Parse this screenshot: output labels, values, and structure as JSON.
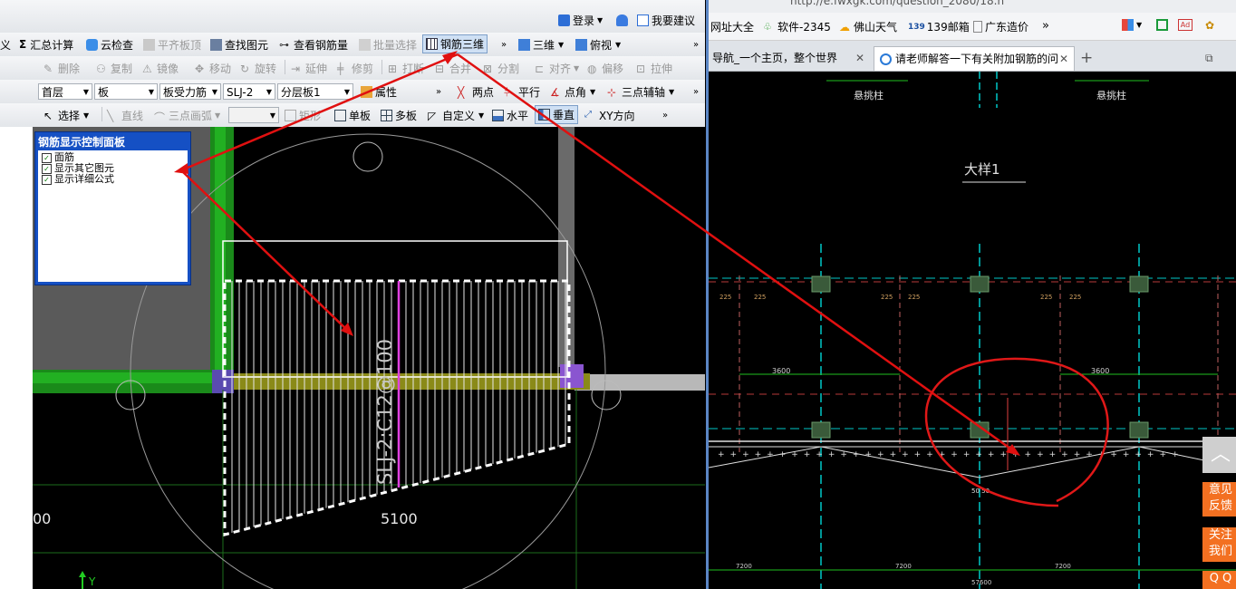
{
  "left_app": {
    "top_partial_menu": "…",
    "top_right": {
      "login": "登录",
      "feedback": "我要建议"
    },
    "toolbar1": {
      "partial": "义",
      "calc": "汇总计算",
      "cloud_check": "云检查",
      "flat_top": "平齐板顶",
      "find_element": "查找图元",
      "view_rebar": "查看钢筋量",
      "batch_select": "批量选择",
      "rebar_3d": "钢筋三维",
      "view_3d": "三维",
      "top_view": "俯视"
    },
    "toolbar2": [
      "删除",
      "复制",
      "镜像",
      "移动",
      "旋转",
      "延伸",
      "修剪",
      "打断",
      "合并",
      "分割",
      "对齐",
      "偏移",
      "拉伸"
    ],
    "toolbar3": {
      "floor": "首层",
      "category": "板",
      "type": "板受力筋",
      "name": "SLJ-2",
      "layer": "分层板1",
      "property": "属性",
      "two_points": "两点",
      "parallel": "平行",
      "point_angle": "点角",
      "three_point_aux": "三点辅轴"
    },
    "toolbar4": {
      "select": "选择",
      "line": "直线",
      "three_point_arc": "三点画弧",
      "rect": "矩形",
      "single_board": "单板",
      "multi_board": "多板",
      "custom": "自定义",
      "horizontal": "水平",
      "vertical": "垂直",
      "xy_direction": "XY方向"
    },
    "panel": {
      "title": "钢筋显示控制面板",
      "items": [
        {
          "label": "面筋",
          "checked": true
        },
        {
          "label": "显示其它图元",
          "checked": true
        },
        {
          "label": "显示详细公式",
          "checked": true
        }
      ]
    },
    "canvas": {
      "rebar_label": "SLJ-2:C12@100",
      "dim_left": "00",
      "dim_mid": "5100",
      "axis_y": "Y"
    }
  },
  "browser": {
    "url_partial": "http://e.fwxgk.com/question_2080/18.h",
    "bookmarks": [
      "网址大全",
      "软件-2345",
      "佛山天气",
      "139邮箱",
      "广东造价"
    ],
    "tabs": [
      {
        "label": "导航_一个主页，整个世界",
        "active": false
      },
      {
        "label": "请老师解答一下有关附加钢筋的问",
        "active": true
      }
    ],
    "drawing": {
      "section_title": "大样1",
      "header_left": "悬挑柱",
      "header_right": "悬挑柱",
      "dim_1": "3600",
      "dim_2": "3600",
      "bottom_dims": [
        "7200",
        "7200",
        "7200"
      ],
      "bottom_total": "57600",
      "small_labels": [
        "225",
        "225",
        "225",
        "225",
        "225",
        "225"
      ],
      "callout": "50 50"
    },
    "side_buttons": [
      "意见\n反馈",
      "关注\n我们",
      "Q Q"
    ]
  },
  "colors": {
    "toolbar_bg": "#e6e9ed",
    "panel_blue": "#1550c4",
    "arrow_red": "#e01010",
    "cad_green": "#00cc33",
    "cad_cyan": "#00c8c8",
    "accent_orange": "#f37021"
  }
}
